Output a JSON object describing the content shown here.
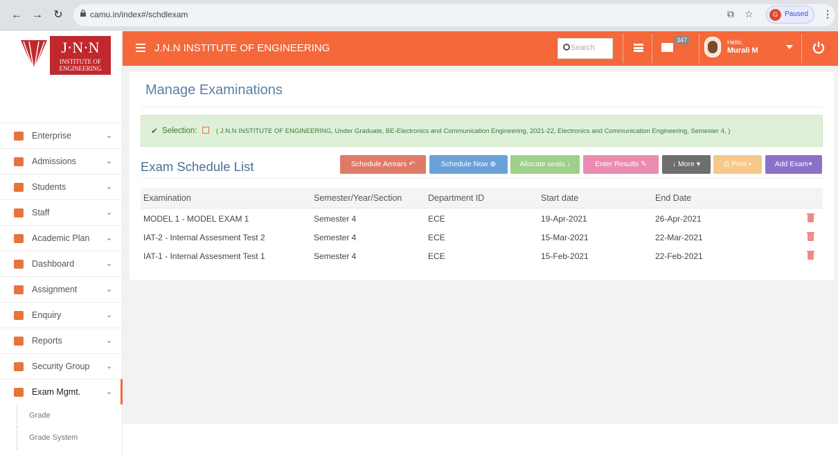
{
  "browser": {
    "url": "camu.in/index#/schdlexam",
    "paused_label": "Paused",
    "profile_initial": "G"
  },
  "header": {
    "brand": "J.N.N INSTITUTE OF ENGINEERING",
    "search_placeholder": "Search",
    "mail_count": "347",
    "hello": "Hello,",
    "user_name": "Murali M",
    "color": "#f4683a"
  },
  "logo": {
    "top": "J·N·N",
    "line1": "INSTITUTE OF",
    "line2": "ENGINEERING"
  },
  "sidebar": {
    "items": [
      {
        "label": "Enterprise",
        "icon": "enterprise-icon",
        "color": "#e8743b"
      },
      {
        "label": "Admissions",
        "icon": "admissions-icon",
        "color": "#e8743b"
      },
      {
        "label": "Students",
        "icon": "students-icon",
        "color": "#e8743b"
      },
      {
        "label": "Staff",
        "icon": "staff-icon",
        "color": "#e8743b"
      },
      {
        "label": "Academic Plan",
        "icon": "academic-plan-icon",
        "color": "#e8743b"
      },
      {
        "label": "Dashboard",
        "icon": "dashboard-icon",
        "color": "#e8743b"
      },
      {
        "label": "Assignment",
        "icon": "assignment-icon",
        "color": "#e8743b"
      },
      {
        "label": "Enquiry",
        "icon": "enquiry-icon",
        "color": "#e8743b"
      },
      {
        "label": "Reports",
        "icon": "reports-icon",
        "color": "#e8743b"
      },
      {
        "label": "Security Group",
        "icon": "security-group-icon",
        "color": "#e8743b"
      },
      {
        "label": "Exam Mgmt.",
        "icon": "exam-mgmt-icon",
        "color": "#e8743b"
      }
    ],
    "subitems": [
      "Grade",
      "Grade System"
    ]
  },
  "main": {
    "page_title": "Manage Examinations",
    "selection_label": "Selection:",
    "selection_text": "( J.N.N INSTITUTE OF ENGINEERING, Under Graduate, BE-Electronics and Communication Engineering, 2021-22, Electronics and Communication Engineering, Semester 4, )",
    "list_title": "Exam Schedule List",
    "buttons": {
      "schedule_arrears": "Schedule Arrears",
      "schedule_now": "Schedule Now",
      "allocate_seats": "Allocate seats",
      "enter_results": "Enter Results",
      "more": "More",
      "print": "Print",
      "add_exam": "Add Exam"
    },
    "columns": [
      "Examination",
      "Semester/Year/Section",
      "Department ID",
      "Start date",
      "End Date"
    ],
    "rows": [
      [
        "MODEL 1 - MODEL EXAM 1",
        "Semester 4",
        "ECE",
        "19-Apr-2021",
        "26-Apr-2021"
      ],
      [
        "IAT-2 - Internal Assesment Test 2",
        "Semester 4",
        "ECE",
        "15-Mar-2021",
        "22-Mar-2021"
      ],
      [
        "IAT-1 - Internal Assesment Test 1",
        "Semester 4",
        "ECE",
        "15-Feb-2021",
        "22-Feb-2021"
      ]
    ]
  }
}
